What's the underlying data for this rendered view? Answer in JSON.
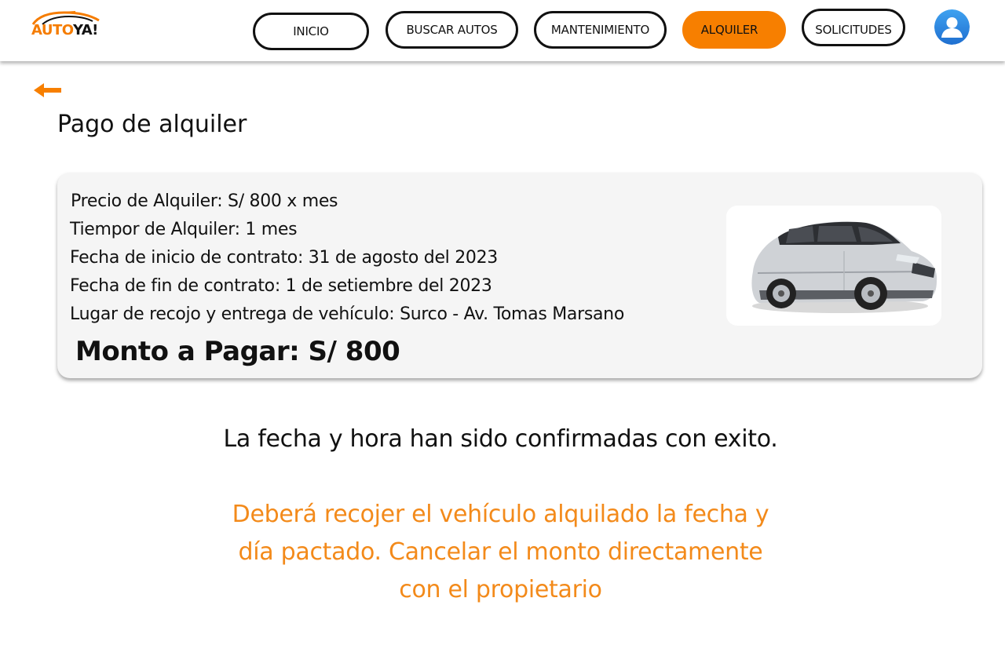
{
  "header": {
    "logo_part1": "AUTO",
    "logo_part2": "YA!",
    "nav": [
      {
        "label": "INICIO"
      },
      {
        "label": "BUSCAR AUTOS"
      },
      {
        "label": "MANTENIMIENTO"
      },
      {
        "label": "ALQUILER"
      },
      {
        "label": "SOLICITUDES"
      }
    ],
    "active_tab": "ALQUILER",
    "avatar_icon": "user-avatar-icon"
  },
  "page": {
    "back_icon": "arrow-left-icon",
    "title": "Pago de alquiler"
  },
  "details": {
    "price": " Precio de Alquiler:  S/ 800 x mes",
    "duration": "Tiempor de Alquiler: 1 mes",
    "start_date": "Fecha de inicio de contrato: 31 de agosto del 2023",
    "end_date": "Fecha de fin de contrato: 1 de setiembre del 2023",
    "location": "Lugar de recojo y entrega de vehículo: Surco - Av. Tomas Marsano",
    "amount": "Monto a Pagar:  S/ 800"
  },
  "confirmation": {
    "line1": "La fecha y hora han sido confirmadas con exito.",
    "line2": "Deberá  recojer el vehículo alquilado la fecha y día pactado. Cancelar el monto directamente con el propietario"
  },
  "colors": {
    "accent": "#f77f00",
    "message_orange": "#f38a1a",
    "card_bg": "#f5f5f5",
    "avatar_blue": "#2f8de4"
  }
}
